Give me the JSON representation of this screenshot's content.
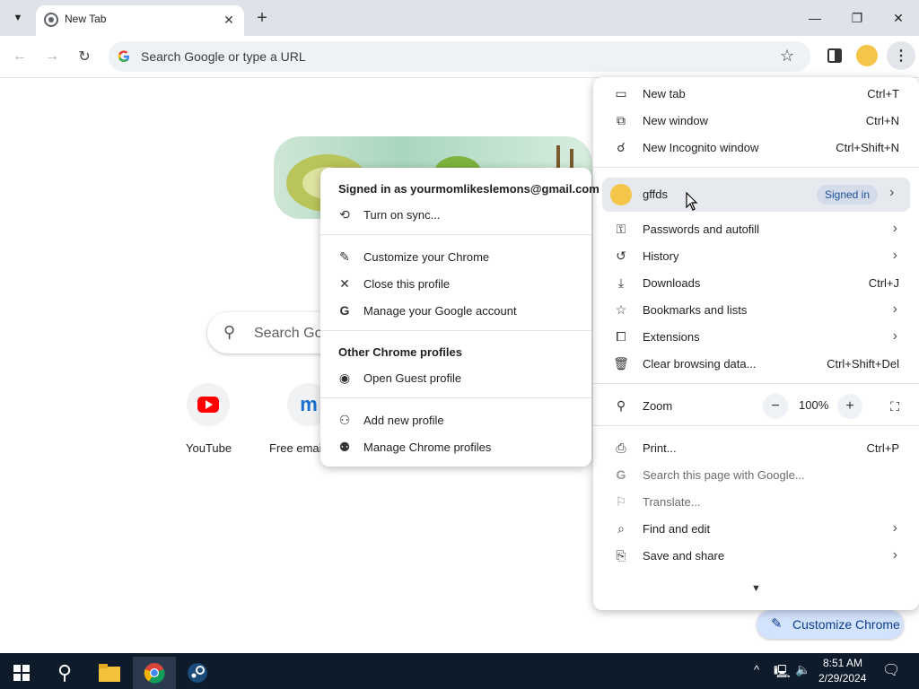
{
  "tabs": [
    {
      "title": "New Tab",
      "active": true
    }
  ],
  "omnibox": {
    "placeholder": "Search Google or type a URL"
  },
  "ntp": {
    "search_placeholder": "Search Goo",
    "shortcuts": [
      {
        "label": "YouTube",
        "icon": "youtube-icon"
      },
      {
        "label": "Free emai",
        "icon": "m-icon"
      }
    ],
    "customize_label": "Customize Chrome"
  },
  "menu": {
    "items": [
      {
        "label": "New tab",
        "shortcut": "Ctrl+T",
        "icon": "new-tab-icon"
      },
      {
        "label": "New window",
        "shortcut": "Ctrl+N",
        "icon": "new-window-icon"
      },
      {
        "label": "New Incognito window",
        "shortcut": "Ctrl+Shift+N",
        "icon": "incognito-icon"
      }
    ],
    "profile": {
      "name": "gffds",
      "badge": "Signed in"
    },
    "items2": [
      {
        "label": "Passwords and autofill",
        "icon": "key-icon",
        "has_arrow": true
      },
      {
        "label": "History",
        "icon": "history-icon",
        "has_arrow": true
      },
      {
        "label": "Downloads",
        "shortcut": "Ctrl+J",
        "icon": "download-icon"
      },
      {
        "label": "Bookmarks and lists",
        "icon": "star-icon",
        "has_arrow": true
      },
      {
        "label": "Extensions",
        "icon": "puzzle-icon",
        "has_arrow": true
      },
      {
        "label": "Clear browsing data...",
        "shortcut": "Ctrl+Shift+Del",
        "icon": "trash-icon"
      }
    ],
    "zoom": {
      "label": "Zoom",
      "value": "100%"
    },
    "items3": [
      {
        "label": "Print...",
        "shortcut": "Ctrl+P",
        "icon": "print-icon"
      },
      {
        "label": "Search this page with Google...",
        "icon": "google-g-icon",
        "disabled": true
      },
      {
        "label": "Translate...",
        "icon": "translate-icon",
        "disabled": true
      },
      {
        "label": "Find and edit",
        "icon": "find-icon",
        "has_arrow": true
      },
      {
        "label": "Save and share",
        "icon": "save-share-icon",
        "has_arrow": true
      }
    ]
  },
  "profile_menu": {
    "signed_in_as": "Signed in as yourmomlikeslemons@gmail.com",
    "sync": "Turn on sync...",
    "customize": "Customize your Chrome",
    "close_profile": "Close this profile",
    "manage_account": "Manage your Google account",
    "other_header": "Other Chrome profiles",
    "guest": "Open Guest profile",
    "add_profile": "Add new profile",
    "manage_profiles": "Manage Chrome profiles"
  },
  "taskbar": {
    "time": "8:51 AM",
    "date": "2/29/2024"
  }
}
